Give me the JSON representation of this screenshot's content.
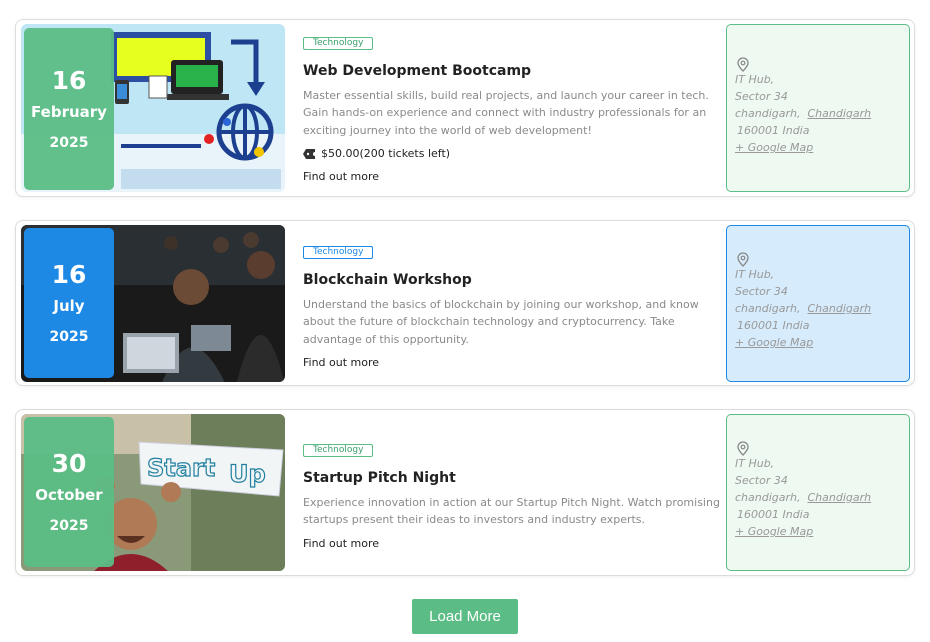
{
  "events": [
    {
      "day": "16",
      "month": "February",
      "year": "2025",
      "category": "Technology",
      "title": "Web Development Bootcamp",
      "description": "Master essential skills, build real projects, and launch your career in tech. Gain hands-on experience and connect with industry professionals for an exciting journey into the world of web development!",
      "price": "$50.00(200 tickets left)",
      "link": "Find out more",
      "location": {
        "venue": "IT Hub,",
        "street": "Sector 34",
        "city_prefix": "chandigarh,",
        "city": "Chandigarh",
        "postal": "160001  India",
        "map": "+ Google Map"
      },
      "accent": "#5bbd85",
      "location_bg": "#eef9f2"
    },
    {
      "day": "16",
      "month": "July",
      "year": "2025",
      "category": "Technology",
      "title": "Blockchain Workshop",
      "description": "Understand the basics of blockchain by joining our workshop, and know about the future of blockchain technology and cryptocurrency. Take advantage of this opportunity.",
      "link": "Find out more",
      "location": {
        "venue": "IT Hub,",
        "street": "Sector 34",
        "city_prefix": "chandigarh,",
        "city": "Chandigarh",
        "postal": "160001  India",
        "map": "+ Google Map"
      },
      "accent": "#1e88e5",
      "location_bg": "#d6ebfc"
    },
    {
      "day": "30",
      "month": "October",
      "year": "2025",
      "category": "Technology",
      "title": "Startup Pitch Night",
      "description": "Experience innovation in action at our Startup Pitch Night. Watch promising startups present their ideas to investors and industry experts.",
      "link": "Find out more",
      "location": {
        "venue": "IT Hub,",
        "street": "Sector 34",
        "city_prefix": "chandigarh,",
        "city": "Chandigarh",
        "postal": "160001  India",
        "map": "+ Google Map"
      },
      "accent": "#5bbd85",
      "location_bg": "#eef9f2",
      "image_sign": [
        "Start",
        "Up"
      ]
    }
  ],
  "load_more_label": "Load More",
  "icons": [
    "location-pin-icon",
    "ticket-icon"
  ]
}
